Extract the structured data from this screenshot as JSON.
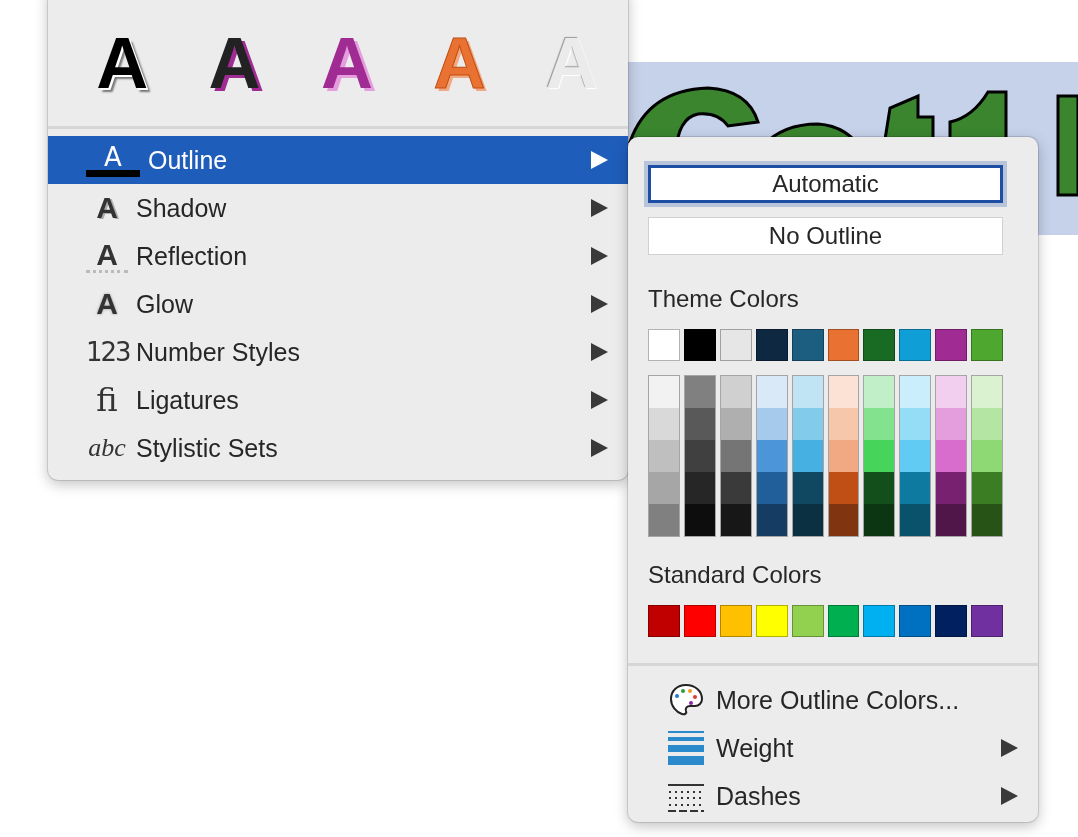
{
  "effects_menu": {
    "presets": [
      {
        "label": "A",
        "kind": "black-shadow"
      },
      {
        "label": "A",
        "kind": "black-purple-shadow"
      },
      {
        "label": "A",
        "kind": "purple-pink-shadow"
      },
      {
        "label": "A",
        "kind": "orange-outline"
      },
      {
        "label": "A",
        "kind": "grey-emboss"
      }
    ],
    "items": [
      {
        "label": "Outline",
        "icon": "A",
        "kind": "underline",
        "selected": true
      },
      {
        "label": "Shadow",
        "icon": "A",
        "kind": "shadow",
        "selected": false
      },
      {
        "label": "Reflection",
        "icon": "A",
        "kind": "reflection",
        "selected": false
      },
      {
        "label": "Glow",
        "icon": "A",
        "kind": "glow",
        "selected": false
      },
      {
        "label": "Number Styles",
        "icon": "123",
        "kind": "numbers",
        "selected": false
      },
      {
        "label": "Ligatures",
        "icon": "fi",
        "kind": "ligature",
        "selected": false
      },
      {
        "label": "Stylistic Sets",
        "icon": "abc",
        "kind": "italic",
        "selected": false
      }
    ]
  },
  "outline_submenu": {
    "options": [
      {
        "label": "Automatic",
        "selected": true
      },
      {
        "label": "No Outline",
        "selected": false
      }
    ],
    "theme_heading": "Theme Colors",
    "theme_colors": [
      {
        "color": "#ffffff"
      },
      {
        "color": "#000000"
      },
      {
        "color": "#e7e6e6"
      },
      {
        "color": "#0e2841"
      },
      {
        "color": "#1b5e80"
      },
      {
        "color": "#e97132"
      },
      {
        "color": "#196b24"
      },
      {
        "color": "#0f9ed5"
      },
      {
        "color": "#a02b93"
      },
      {
        "color": "#4ea72e"
      }
    ],
    "shades": [
      {
        "colors": [
          {
            "color": "#f2f2f2"
          },
          {
            "color": "#d9d9d9"
          },
          {
            "color": "#bfbfbf"
          },
          {
            "color": "#a6a6a6"
          },
          {
            "color": "#808080"
          }
        ]
      },
      {
        "colors": [
          {
            "color": "#808080"
          },
          {
            "color": "#595959"
          },
          {
            "color": "#404040"
          },
          {
            "color": "#262626"
          },
          {
            "color": "#0d0d0d"
          }
        ]
      },
      {
        "colors": [
          {
            "color": "#d0d0d0"
          },
          {
            "color": "#afafaf"
          },
          {
            "color": "#757575"
          },
          {
            "color": "#3a3a3a"
          },
          {
            "color": "#171717"
          }
        ]
      },
      {
        "colors": [
          {
            "color": "#dae9f7"
          },
          {
            "color": "#a6caec"
          },
          {
            "color": "#4d95d9"
          },
          {
            "color": "#215f9a"
          },
          {
            "color": "#153d64"
          }
        ]
      },
      {
        "colors": [
          {
            "color": "#c1e4f5"
          },
          {
            "color": "#83cbeb"
          },
          {
            "color": "#45b0e1"
          },
          {
            "color": "#104862"
          },
          {
            "color": "#0b3041"
          }
        ]
      },
      {
        "colors": [
          {
            "color": "#fbe2d5"
          },
          {
            "color": "#f7c7ac"
          },
          {
            "color": "#f1a983"
          },
          {
            "color": "#c04f15"
          },
          {
            "color": "#803510"
          }
        ]
      },
      {
        "colors": [
          {
            "color": "#c1f0c8"
          },
          {
            "color": "#83e28e"
          },
          {
            "color": "#47d45a"
          },
          {
            "color": "#124f1a"
          },
          {
            "color": "#0c3511"
          }
        ]
      },
      {
        "colors": [
          {
            "color": "#caeefb"
          },
          {
            "color": "#95dcf7"
          },
          {
            "color": "#61cbf3"
          },
          {
            "color": "#0f7aa0"
          },
          {
            "color": "#0a516b"
          }
        ]
      },
      {
        "colors": [
          {
            "color": "#f2ceef"
          },
          {
            "color": "#e59edd"
          },
          {
            "color": "#d86dcd"
          },
          {
            "color": "#782170"
          },
          {
            "color": "#501549"
          }
        ]
      },
      {
        "colors": [
          {
            "color": "#daf2d0"
          },
          {
            "color": "#b4e5a2"
          },
          {
            "color": "#8ed973"
          },
          {
            "color": "#3b7d23"
          },
          {
            "color": "#275317"
          }
        ]
      }
    ],
    "standard_heading": "Standard Colors",
    "standard_colors": [
      {
        "color": "#c00000"
      },
      {
        "color": "#ff0000"
      },
      {
        "color": "#ffc000"
      },
      {
        "color": "#ffff00"
      },
      {
        "color": "#92d050"
      },
      {
        "color": "#00b050"
      },
      {
        "color": "#00b0f0"
      },
      {
        "color": "#0070c0"
      },
      {
        "color": "#002060"
      },
      {
        "color": "#7030a0"
      }
    ],
    "items": [
      {
        "label": "More Outline Colors...",
        "kind": "palette",
        "submenu": false
      },
      {
        "label": "Weight",
        "kind": "weight",
        "submenu": true
      },
      {
        "label": "Dashes",
        "kind": "dashes",
        "submenu": true
      }
    ]
  }
}
